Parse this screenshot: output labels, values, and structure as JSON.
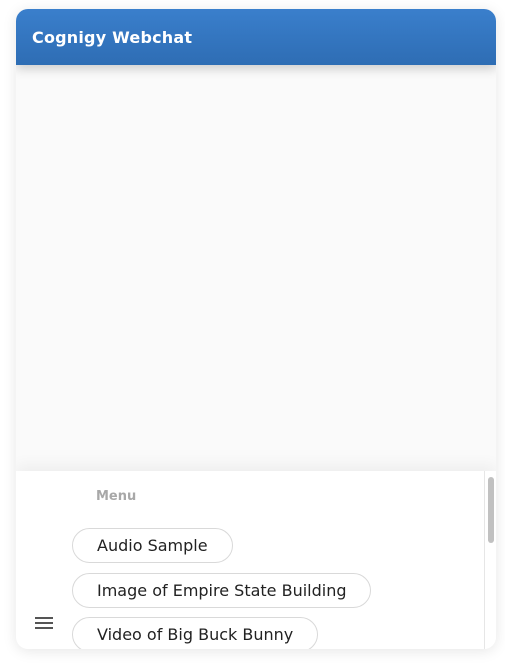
{
  "header": {
    "title": "Cognigy Webchat",
    "background_color": "#3474c1"
  },
  "menu": {
    "title": "Menu",
    "items": [
      {
        "label": "Audio Sample"
      },
      {
        "label": "Image of Empire State Building"
      },
      {
        "label": "Video of Big Buck Bunny"
      }
    ],
    "toggle_icon": "hamburger-menu-icon"
  }
}
